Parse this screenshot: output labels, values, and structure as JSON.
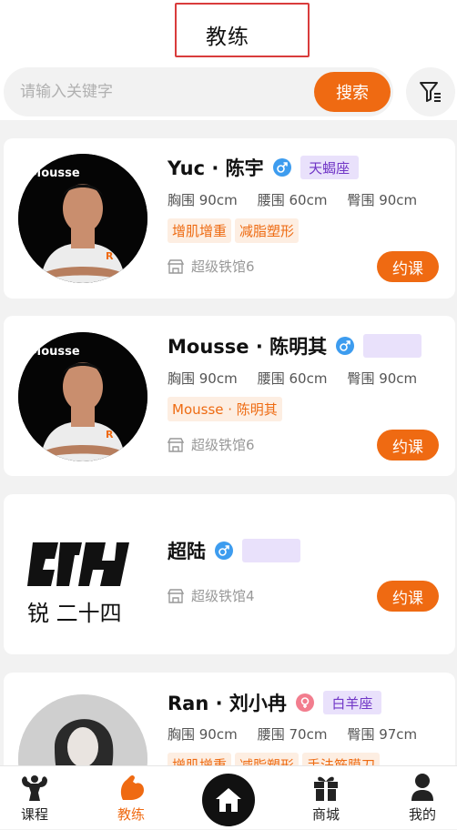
{
  "header": {
    "title": "教练"
  },
  "search": {
    "placeholder": "请输入关键字",
    "button_label": "搜索"
  },
  "coaches": [
    {
      "name": "Yuc · 陈宇",
      "gender": "male",
      "zodiac": "天蝎座",
      "avatar_text": "•Mousse",
      "measurements": [
        "胸围 90cm",
        "腰围 60cm",
        "臀围 90cm"
      ],
      "tags": [
        "增肌增重",
        "减脂塑形"
      ],
      "gym": "超级铁馆6",
      "book_label": "约课"
    },
    {
      "name": "Mousse · 陈明其",
      "gender": "male",
      "zodiac": "",
      "avatar_text": "•Mousse",
      "measurements": [
        "胸围 90cm",
        "腰围 60cm",
        "臀围 90cm"
      ],
      "tags": [
        "Mousse · 陈明其"
      ],
      "gym": "超级铁馆6",
      "book_label": "约课"
    },
    {
      "name": "超陆",
      "gender": "male",
      "zodiac": "",
      "avatar_text": "锐 二十四",
      "gym": "超级铁馆4",
      "book_label": "约课"
    },
    {
      "name": "Ran · 刘小冉",
      "gender": "female",
      "zodiac": "白羊座",
      "measurements": [
        "胸围 90cm",
        "腰围 70cm",
        "臀围 97cm"
      ],
      "tags": [
        "增肌增重",
        "减脂塑形",
        "手法筋膜刀"
      ]
    }
  ],
  "tabbar": {
    "items": [
      {
        "label": "课程",
        "icon": "muscle-figure-icon"
      },
      {
        "label": "教练",
        "icon": "flexed-arm-icon",
        "active": true
      },
      {
        "label": "",
        "icon": "home-icon"
      },
      {
        "label": "商城",
        "icon": "gift-icon"
      },
      {
        "label": "我的",
        "icon": "user-icon"
      }
    ]
  },
  "colors": {
    "accent": "#ef6a12",
    "male": "#3d9cef",
    "female": "#f27d8e",
    "zodiac_bg": "#e9e1fb",
    "zodiac_text": "#7035c6",
    "highlight_box": "#d93c3c"
  }
}
